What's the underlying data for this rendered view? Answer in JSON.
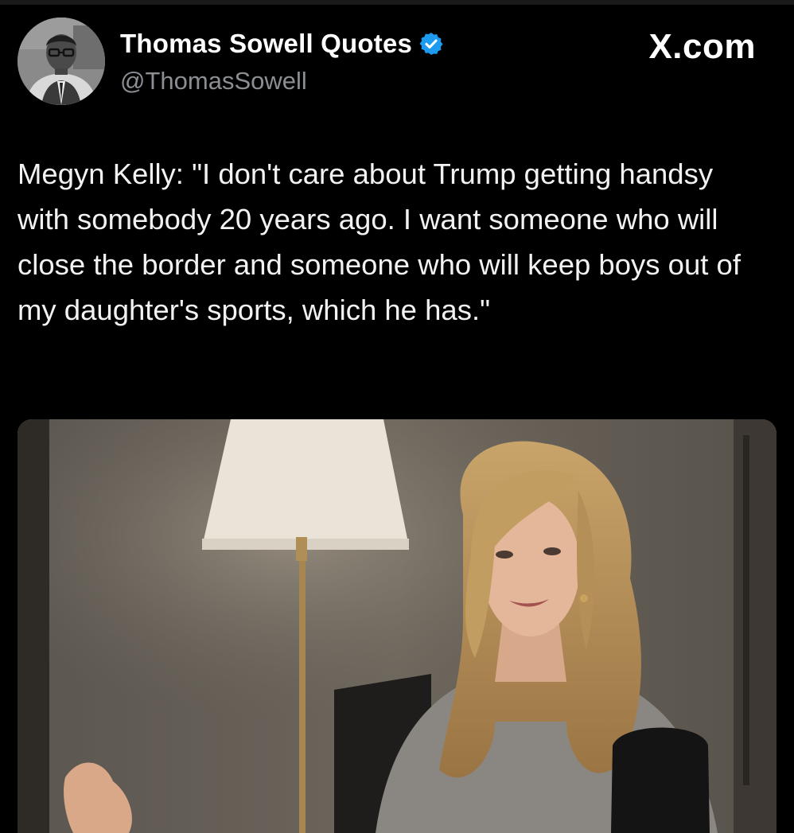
{
  "post": {
    "author_name": "Thomas Sowell Quotes",
    "author_handle": "@ThomasSowell",
    "verified": true,
    "brand": "X.com",
    "text": "Megyn Kelly: \"I don't care about Trump getting handsy with somebody 20 years ago. I want someone who will close the border and someone who will keep boys out of my daughter's sports, which he has.\""
  },
  "colors": {
    "background": "#000000",
    "text_primary": "#ffffff",
    "text_secondary": "#8b8f94",
    "verified_badge": "#1d9bf0"
  },
  "icons": {
    "verified": "verified-badge-icon"
  }
}
